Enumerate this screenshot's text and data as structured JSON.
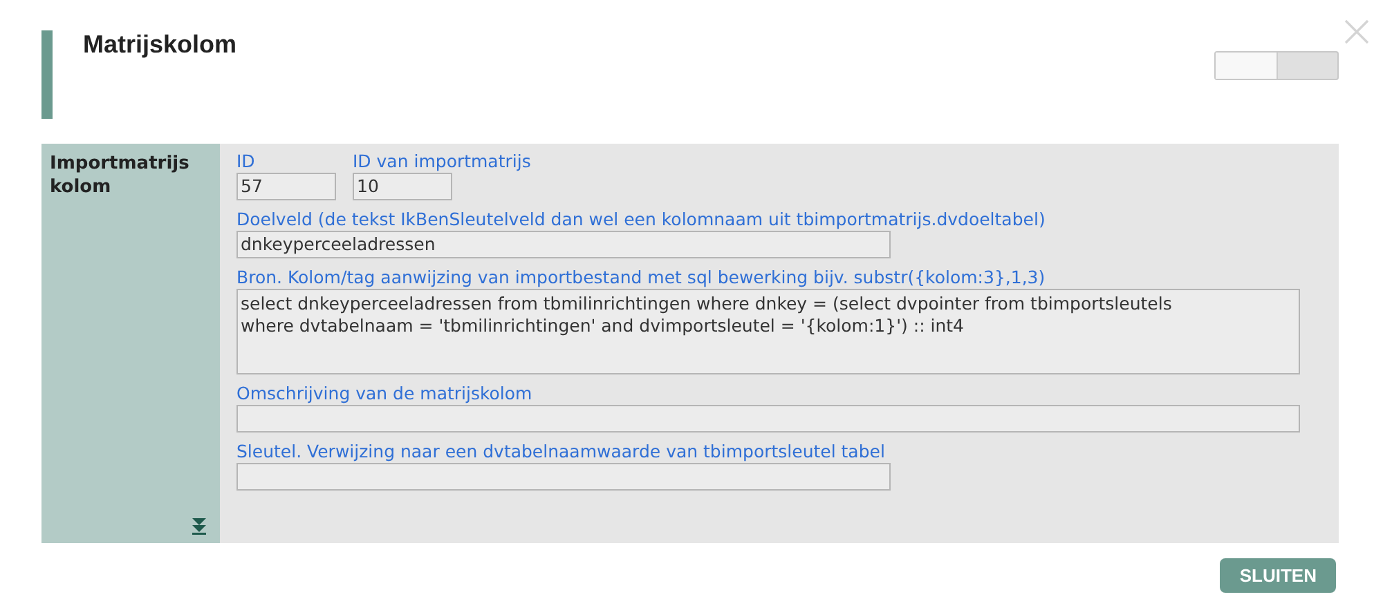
{
  "dialog": {
    "title": "Matrijskolom",
    "toggle": {
      "on": false
    }
  },
  "sidebar": {
    "label": "Importmatrijs kolom"
  },
  "id_fields": [
    {
      "label": "ID",
      "value": "57"
    },
    {
      "label": "ID van importmatrijs",
      "value": "10"
    }
  ],
  "fields": [
    {
      "kind": "short",
      "label": "Doelveld (de tekst IkBenSleutelveld dan wel een kolomnaam uit tbimportmatrijs.dvdoeltabel)",
      "value_lines": [
        "dnkeyperceeladressen"
      ]
    },
    {
      "kind": "area",
      "label": "Bron. Kolom/tag aanwijzing van importbestand met sql bewerking bijv. substr({kolom:3},1,3)",
      "value_lines": [
        "select dnkeyperceeladressen from tbmilinrichtingen where dnkey = (select dvpointer from tbimportsleutels",
        "where dvtabelnaam = 'tbmilinrichtingen' and dvimportsleutel = '{kolom:1}') :: int4"
      ]
    },
    {
      "kind": "long",
      "label": "Omschrijving van de matrijskolom"
    },
    {
      "kind": "short",
      "label": "Sleutel. Verwijzing naar een dvtabelnaamwaarde van tbimportsleutel tabel"
    }
  ],
  "buttons": [
    {
      "label": "SLUITEN"
    }
  ]
}
